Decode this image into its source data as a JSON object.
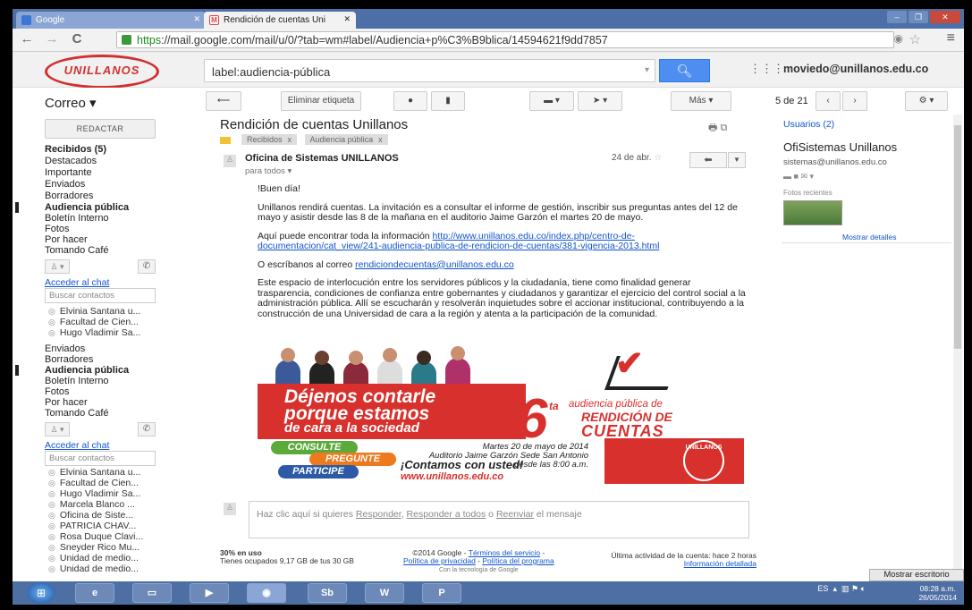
{
  "browser": {
    "tabs": [
      {
        "label": "Google"
      },
      {
        "label": "Rendición de cuentas Uni"
      }
    ],
    "url_scheme": "https",
    "url_rest": "://mail.google.com/mail/u/0/?tab=wm#label/Audiencia+p%C3%B9blica/14594621f9dd7857"
  },
  "header": {
    "logo_text": "UNILLANOS",
    "search_value": "label:audiencia-pública",
    "user_email": "moviedo@unillanos.edu.co"
  },
  "toolbar": {
    "app_label": "Correo",
    "remove_label": "Eliminar etiqueta",
    "more_label": "Más",
    "pager": "5 de 21"
  },
  "sidebar": {
    "compose_label": "REDACTAR",
    "items_top": [
      {
        "label": "Recibidos (5)",
        "bold": true
      },
      {
        "label": "Destacados"
      },
      {
        "label": "Importante"
      },
      {
        "label": "Enviados"
      },
      {
        "label": "Borradores"
      },
      {
        "label": "Audiencia pública",
        "bold": true
      },
      {
        "label": "Boletín Interno"
      },
      {
        "label": "Fotos"
      },
      {
        "label": "Por hacer"
      },
      {
        "label": "Tomando Café"
      }
    ],
    "chat_link": "Acceder al chat",
    "chat_search_placeholder": "Buscar contactos",
    "contacts_top": [
      "Elvinia Santana u...",
      "Facultad de Cien...",
      "Hugo Vladimir Sa..."
    ],
    "items_mid": [
      {
        "label": "Enviados"
      },
      {
        "label": "Borradores"
      },
      {
        "label": "Audiencia pública",
        "bold": true
      },
      {
        "label": "Boletín Interno"
      },
      {
        "label": "Fotos"
      },
      {
        "label": "Por hacer"
      },
      {
        "label": "Tomando Café"
      }
    ],
    "contacts_bottom": [
      "Elvinia Santana u...",
      "Facultad de Cien...",
      "Hugo Vladimir Sa...",
      "Marcela Blanco ...",
      "Oficina de Siste...",
      "PATRICIA CHAV...",
      "Rosa Duque Clavi...",
      "Sneyder Rico Mu...",
      "Unidad de medio...",
      "Unidad de medio..."
    ]
  },
  "message": {
    "subject": "Rendición de cuentas Unillanos",
    "labels": [
      "Recibidos",
      "Audiencia pública"
    ],
    "sender": "Oficina de Sistemas UNILLANOS",
    "to": "para todos",
    "date": "24 de abr.",
    "greeting": "!Buen día!",
    "p1": "Unillanos rendirá cuentas. La invitación es a consultar el informe de gestión, inscribir sus preguntas antes del 12 de mayo y asistir desde las 8 de la mañana en el auditorio Jaime Garzón el martes 20 de mayo.",
    "p2_intro": "Aquí puede encontrar toda la información ",
    "p2_link": "http://www.unillanos.edu.co/index.php/centro-de-documentacion/cat_view/241-audiencia-publica-de-rendicion-de-cuentas/381-vigencia-2013.html",
    "p3_intro": "O escríbanos al correo ",
    "p3_link": "rendiciondecuentas@unillanos.edu.co",
    "p4": "Este espacio de interlocución entre los servidores públicos y la ciudadanía, tiene como finalidad generar trasparencia, condiciones de confianza entre gobernantes y ciudadanos y garantizar el ejercicio del control social a la administración pública. Allí se escucharán y resolverán inquietudes sobre el accionar institucional, contribuyendo a la construcción de una Universidad de cara a la región y atenta a la participación de la comunidad."
  },
  "banner": {
    "headline1": "Déjenos contarle",
    "headline2": "porque estamos",
    "headline3": "de cara a la sociedad",
    "num": "6",
    "ta": "ta",
    "audiencia": "audiencia pública de",
    "rendicion": "RENDICIÓN DE",
    "cuentas": "CUENTAS",
    "consulte": "CONSULTE",
    "pregunte": "PREGUNTE",
    "participe": "PARTICIPE",
    "date_line1": "Martes 20 de mayo de 2014",
    "date_line2": "Auditorio Jaime Garzón Sede San Antonio",
    "date_line3": "desde las 8:00 a.m.",
    "contamos": "¡Contamos con usted!",
    "url": "www.unillanos.edu.co",
    "logo": "UNILLANOS"
  },
  "reply": {
    "prefix": "Haz clic aquí si quieres ",
    "responder": "Responder",
    "sep1": ", ",
    "responder_todos": "Responder a todos",
    "sep2": " o ",
    "reenviar": "Reenviar",
    "suffix": " el mensaje"
  },
  "footer": {
    "usage": "30% en uso",
    "storage": "Tienes ocupados 9,17 GB de tus 30 GB",
    "copyright": "©2014 Google - ",
    "terms": "Términos del servicio",
    "privacy": "Política de privacidad",
    "program": "Política del programa",
    "powered": "Con la tecnología de Google",
    "activity": "Última actividad de la cuenta: hace 2 horas",
    "details": "Información detallada"
  },
  "right_panel": {
    "users_label": "Usuarios (2)",
    "name": "OfiSistemas Unillanos",
    "email": "sistemas@unillanos.edu.co",
    "recent_photos": "Fotos recientes",
    "show_details": "Mostrar detalles"
  },
  "desktop": {
    "show_desktop": "Mostrar escritorio",
    "lang": "ES",
    "time": "08:28 a.m.",
    "date": "26/05/2014",
    "task_items": [
      "",
      "",
      "",
      "",
      "",
      "Sb",
      "W",
      "P"
    ]
  }
}
